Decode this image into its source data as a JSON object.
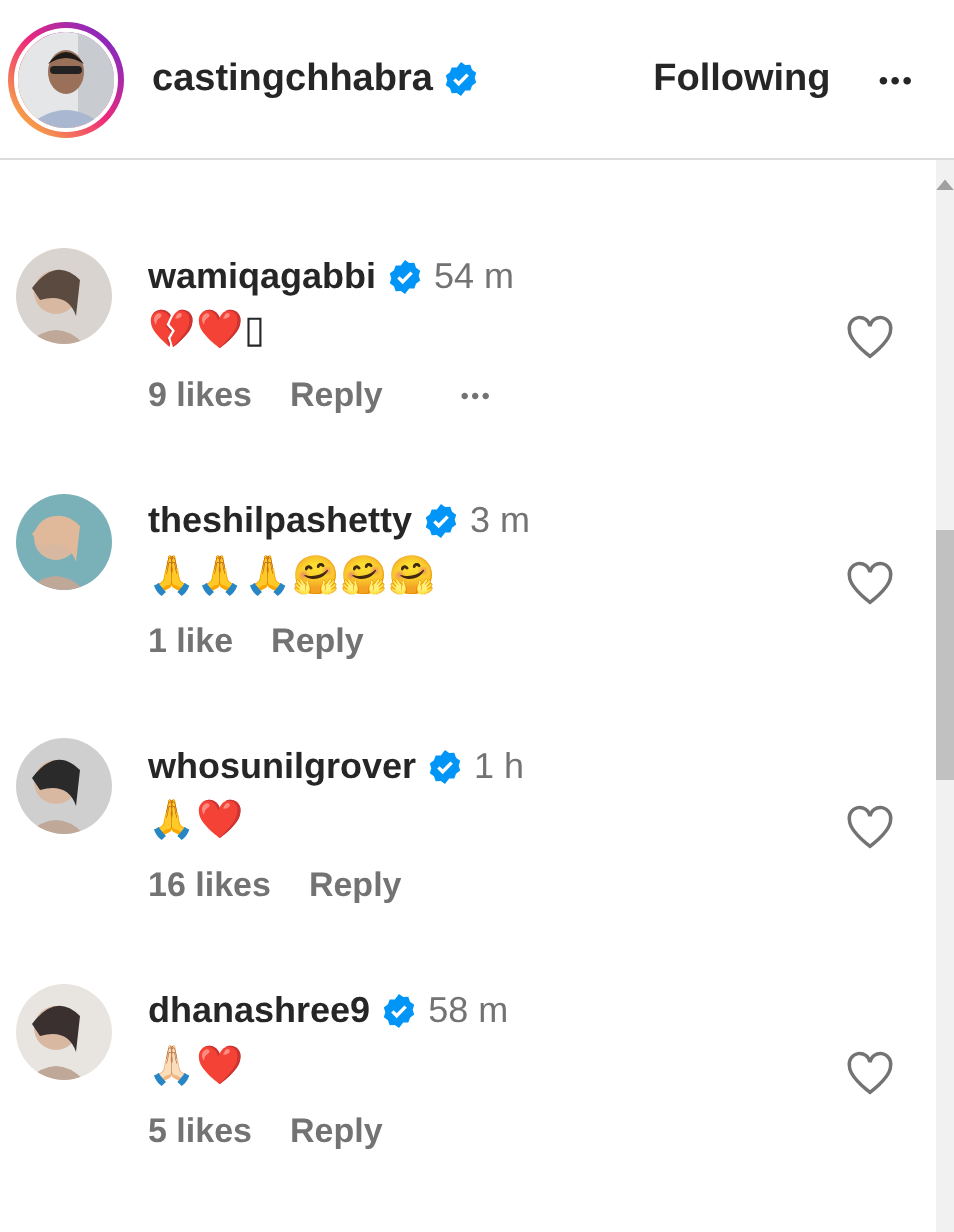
{
  "header": {
    "username": "castingchhabra",
    "verified": true,
    "follow_label": "Following",
    "more": "•••"
  },
  "comments": [
    {
      "username": "wamiqagabbi",
      "verified": true,
      "time": "54 m",
      "text": "💔❤️▯",
      "likes": "9 likes",
      "reply": "Reply",
      "more": "•••",
      "liked": false
    },
    {
      "username": "theshilpashetty",
      "verified": true,
      "time": "3 m",
      "text": "🙏🙏🙏🤗🤗🤗",
      "likes": "1 like",
      "reply": "Reply",
      "liked": false
    },
    {
      "username": "whosunilgrover",
      "verified": true,
      "time": "1 h",
      "text": "🙏❤️",
      "likes": "16 likes",
      "reply": "Reply",
      "liked": false
    },
    {
      "username": "dhanashree9",
      "verified": true,
      "time": "58 m",
      "text": "🙏🏻❤️",
      "likes": "5 likes",
      "reply": "Reply",
      "liked": false
    }
  ]
}
